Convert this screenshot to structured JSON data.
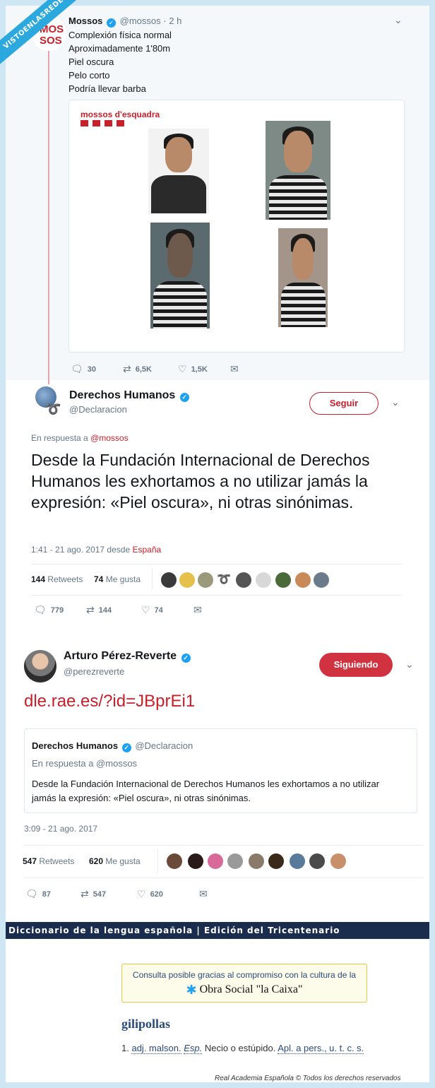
{
  "watermark": "VISTOENLASREDES",
  "tweet1": {
    "avatar_text": [
      "MOS",
      "SOS"
    ],
    "name": "Mossos",
    "handle": "@mossos",
    "time": "· 2 h",
    "lines": [
      "Complexión física normal",
      "Aproximadamente 1'80m",
      "Piel oscura",
      "Pelo corto",
      "Podría llevar barba"
    ],
    "media_title": "mossos d'esquadra",
    "replies": "30",
    "retweets": "6,5K",
    "likes": "1,5K"
  },
  "tweet2": {
    "name": "Derechos Humanos",
    "handle": "@Declaracion",
    "follow_label": "Seguir",
    "reply_prefix": "En respuesta a",
    "reply_to": "@mossos",
    "text": "Desde la Fundación Internacional de Derechos Humanos les exhortamos a no utilizar jamás la expresión: «Piel oscura», ni otras sinónimas.",
    "time": "1:41 - 21 ago. 2017 desde",
    "place": "España",
    "retweets_count": "144",
    "retweets_label": "Retweets",
    "likes_count": "74",
    "likes_label": "Me gusta",
    "replies": "779",
    "retweets": "144",
    "likes": "74"
  },
  "tweet3": {
    "name": "Arturo Pérez-Reverte",
    "handle": "@perezreverte",
    "following_label": "Siguiendo",
    "link": "dle.rae.es/?id=JBprEi1",
    "quote_name": "Derechos Humanos",
    "quote_handle": "@Declaracion",
    "quote_reply": "En respuesta a @mossos",
    "quote_text": "Desde la Fundación Internacional de Derechos Humanos les exhortamos a no utilizar jamás la expresión: «Piel oscura», ni otras sinónimas.",
    "time": "3:09 - 21 ago. 2017",
    "retweets_count": "547",
    "retweets_label": "Retweets",
    "likes_count": "620",
    "likes_label": "Me gusta",
    "replies": "87",
    "retweets": "547",
    "likes": "620"
  },
  "rae": {
    "bar": "Diccionario de la lengua española  |  Edición del Tricentenario",
    "note": "Consulta posible gracias al compromiso con la cultura de la",
    "sponsor": "Obra Social \"la Caixa\"",
    "word": "gilipollas",
    "def_num": "1.",
    "def_abbr1": "adj. malson.",
    "def_abbr2": "Esp.",
    "def_text": "Necio o estúpido.",
    "def_abbr3": "Apl. a pers., u. t. c. s.",
    "footer": "Real Academia Española © Todos los derechos reservados"
  },
  "icons": {
    "verified": "verified-badge-icon",
    "reply": "reply-icon",
    "retweet": "retweet-icon",
    "like": "heart-icon",
    "dm": "envelope-icon",
    "more": "chevron-down-icon"
  }
}
